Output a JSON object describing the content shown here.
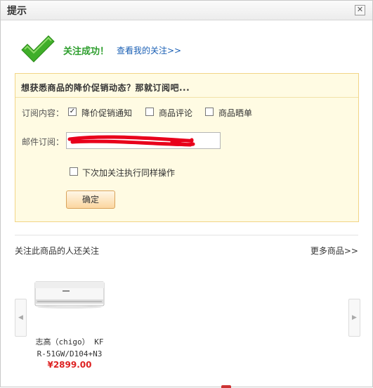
{
  "dialog": {
    "title": "提示",
    "close_glyph": "✕"
  },
  "success": {
    "message": "关注成功！",
    "view_link": "查看我的关注>>"
  },
  "subscribe": {
    "heading": "想获悉商品的降价促销动态？那就订阅吧...",
    "content_label": "订阅内容：",
    "options": [
      {
        "label": "降价促销通知",
        "checked": true
      },
      {
        "label": "商品评论",
        "checked": false
      },
      {
        "label": "商品晒单",
        "checked": false
      }
    ],
    "email_label": "邮件订阅：",
    "email_value_redacted": true,
    "next_time_label": "下次加关注执行同样操作",
    "next_time_checked": false,
    "confirm_label": "确定"
  },
  "related": {
    "heading": "关注此商品的人还关注",
    "more_link": "更多商品>>",
    "prev_glyph": "◀",
    "next_glyph": "▶",
    "products": [
      {
        "name_line1": "志高（chigo） KF",
        "name_line2": "R-51GW/D104+N3",
        "price": "¥2899.00"
      }
    ]
  },
  "colors": {
    "success_green": "#2e9e2e",
    "link_blue": "#1a5fb4",
    "price_red": "#dd2222",
    "panel_bg": "#fffbe3",
    "panel_border": "#f2d587",
    "redaction_red": "#e8001b"
  }
}
